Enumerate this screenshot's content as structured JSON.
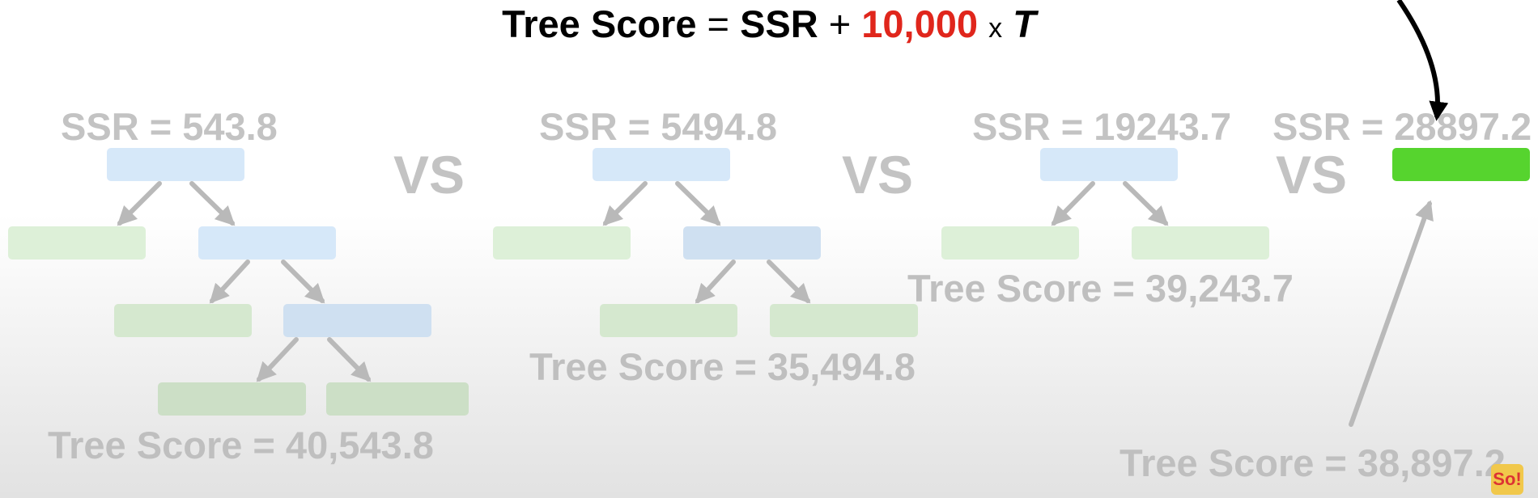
{
  "formula": {
    "lhs": "Tree Score",
    "eq": "=",
    "ssr": "SSR",
    "plus": "+",
    "alpha": "10,000",
    "times": "x",
    "t": "T"
  },
  "vs_label": "VS",
  "trees": [
    {
      "ssr": "SSR = 543.8",
      "score": "Tree Score = 40,543.8"
    },
    {
      "ssr": "SSR = 5494.8",
      "score": "Tree Score = 35,494.8"
    },
    {
      "ssr": "SSR = 19243.7",
      "score": "Tree Score = 39,243.7"
    },
    {
      "ssr": "SSR = 28897.2",
      "score": "Tree Score = 38,897.2"
    }
  ],
  "colors": {
    "internal_node": "#d6e8f9",
    "leaf_node": "#ddf0d8",
    "chosen_leaf": "#56d42e",
    "alpha_highlight": "#e0261c",
    "faded_text": "#c3c3c3"
  },
  "logo": {
    "text": "So!"
  }
}
